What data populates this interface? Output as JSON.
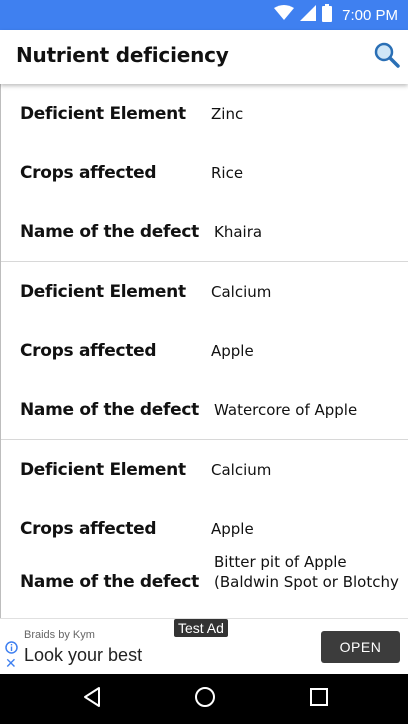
{
  "status_bar": {
    "time": "7:00 PM",
    "icons": [
      "wifi-icon",
      "signal-icon",
      "battery-icon"
    ]
  },
  "app_bar": {
    "title": "Nutrient deficiency",
    "search_icon": "search-icon"
  },
  "entries": [
    {
      "element_label": "Deficient Element",
      "element_value": "Zinc",
      "crops_label": "Crops affected",
      "crops_value": "Rice",
      "defect_label": "Name of the defect",
      "defect_value": "Khaira"
    },
    {
      "element_label": "Deficient Element",
      "element_value": "Calcium",
      "crops_label": "Crops affected",
      "crops_value": "Apple",
      "defect_label": "Name of the defect",
      "defect_value": "Watercore of Apple"
    },
    {
      "element_label": "Deficient Element",
      "element_value": "Calcium",
      "crops_label": "Crops affected",
      "crops_value": "Apple",
      "defect_label": "Name of the defect",
      "defect_value": "Bitter pit of Apple (Baldwin Spot or Blotchy"
    }
  ],
  "ad": {
    "tag": "Test Ad",
    "brand": "Braids by Kym",
    "headline": "Look your best",
    "cta": "OPEN"
  },
  "colors": {
    "status_bar": "#3f80f0",
    "ad_button": "#3c3c3c",
    "nav_bar": "#000000"
  },
  "nav_bar": {
    "icons": [
      "back-icon",
      "home-icon",
      "recents-icon"
    ]
  }
}
